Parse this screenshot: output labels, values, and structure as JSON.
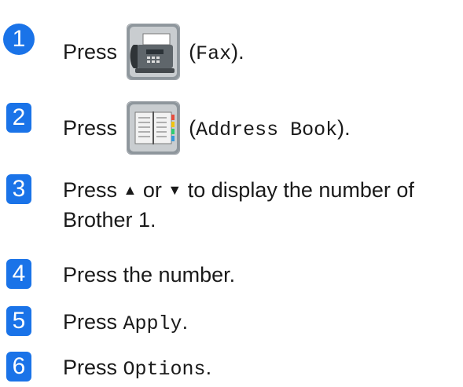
{
  "steps": [
    {
      "number": "1",
      "press": "Press",
      "icon": "fax-icon",
      "paren_open": "(",
      "ui_label": "Fax",
      "paren_close": ")."
    },
    {
      "number": "2",
      "press": "Press",
      "icon": "address-book-icon",
      "paren_open": "(",
      "ui_label": "Address Book",
      "paren_close": ")."
    },
    {
      "number": "3",
      "line1_a": "Press",
      "up_glyph": "▲",
      "or": "or",
      "down_glyph": "▼",
      "line1_b": "to display the number of",
      "line2": "Brother 1."
    },
    {
      "number": "4",
      "text": "Press the number."
    },
    {
      "number": "5",
      "press": "Press",
      "ui_label": "Apply",
      "end": "."
    },
    {
      "number": "6",
      "press": "Press",
      "ui_label": "Options",
      "end": "."
    }
  ],
  "colors": {
    "badge": "#1a73e8",
    "text": "#1a1a1a"
  }
}
